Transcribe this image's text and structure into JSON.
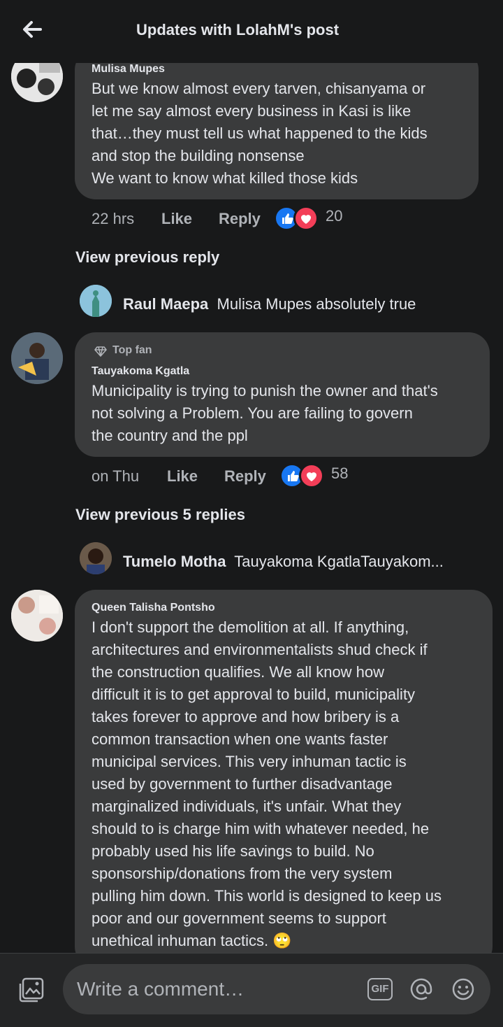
{
  "header": {
    "title": "Updates with LolahM's post"
  },
  "comment1": {
    "author": "Mulisa Mupes",
    "text": "But we know almost every tarven, chisanyama or\nlet me say almost every business in Kasi is like\nthat…they must tell us what happened to the kids\nand stop the building nonsense\nWe want to know what killed those kids",
    "time": "22 hrs",
    "like": "Like",
    "reply": "Reply",
    "reactions": "20"
  },
  "view_prev1": "View previous reply",
  "reply1": {
    "name": "Raul Maepa",
    "text": "Mulisa Mupes absolutely true"
  },
  "comment2": {
    "badge": "Top fan",
    "author": "Tauyakoma Kgatla",
    "text": "Municipality is trying to punish the owner and that's\nnot solving a Problem.  You are failing to govern\nthe country and the ppl",
    "time": "on Thu",
    "like": "Like",
    "reply": "Reply",
    "reactions": "58"
  },
  "view_prev2": "View previous 5 replies",
  "reply2": {
    "name": "Tumelo Motha",
    "text": "Tauyakoma KgatlaTauyakom..."
  },
  "comment3": {
    "author": "Queen Talisha Pontsho",
    "text": "I don't support the demolition at all. If anything,\narchitectures and environmentalists shud check if\nthe construction qualifies. We all know how\ndifficult it is to get approval to build, municipality\ntakes forever to approve and how bribery is a\ncommon transaction when one wants faster\nmunicipal services. This very inhuman tactic is\nused by government to further disadvantage\nmarginalized individuals, it's unfair. What they\nshould to is charge him with whatever needed, he\nprobably used his life savings to build. No\nsponsorship/donations from the very system\npulling him down. This world is designed to keep us\npoor and our government seems to support\nunethical inhuman tactics. 🙄"
  },
  "composer": {
    "placeholder": "Write a comment…",
    "gif": "GIF"
  },
  "colors": {
    "bg": "#18191a",
    "bubble": "#3a3b3c",
    "like": "#1877f2",
    "love": "#f33e58"
  }
}
